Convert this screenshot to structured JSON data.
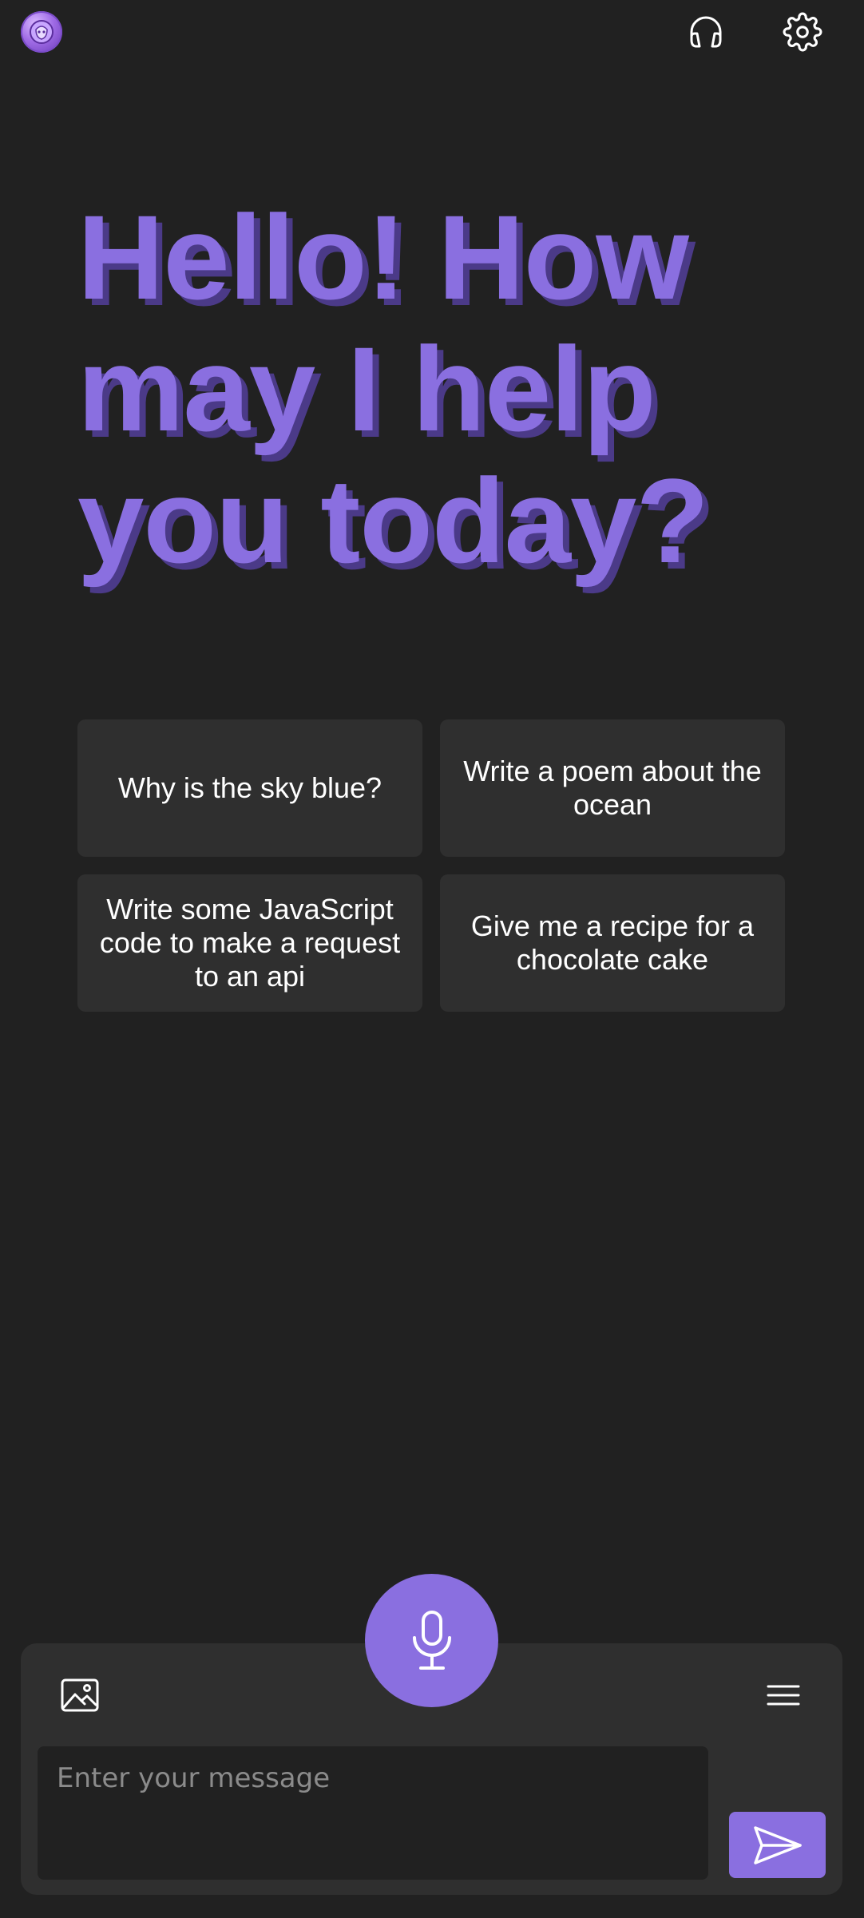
{
  "header": {
    "avatar_icon": "assistant-avatar-icon",
    "headphones_icon": "headphones-icon",
    "settings_icon": "gear-icon"
  },
  "greeting": {
    "line1": "Hello! How",
    "line2": "may I help",
    "line3": "you today?",
    "color": "#8a6fe0"
  },
  "suggestions": [
    {
      "label": "Why is the sky blue?"
    },
    {
      "label": "Write a poem about the ocean"
    },
    {
      "label": "Write some JavaScript code to make a request to an api"
    },
    {
      "label": "Give me a recipe for a chocolate cake"
    }
  ],
  "composer": {
    "placeholder": "Enter your message",
    "value": "",
    "mic_icon": "microphone-icon",
    "image_icon": "image-icon",
    "menu_icon": "hamburger-menu-icon",
    "send_icon": "send-icon"
  },
  "colors": {
    "background": "#212121",
    "surface": "#2f2f2f",
    "accent": "#8a6fe0"
  }
}
